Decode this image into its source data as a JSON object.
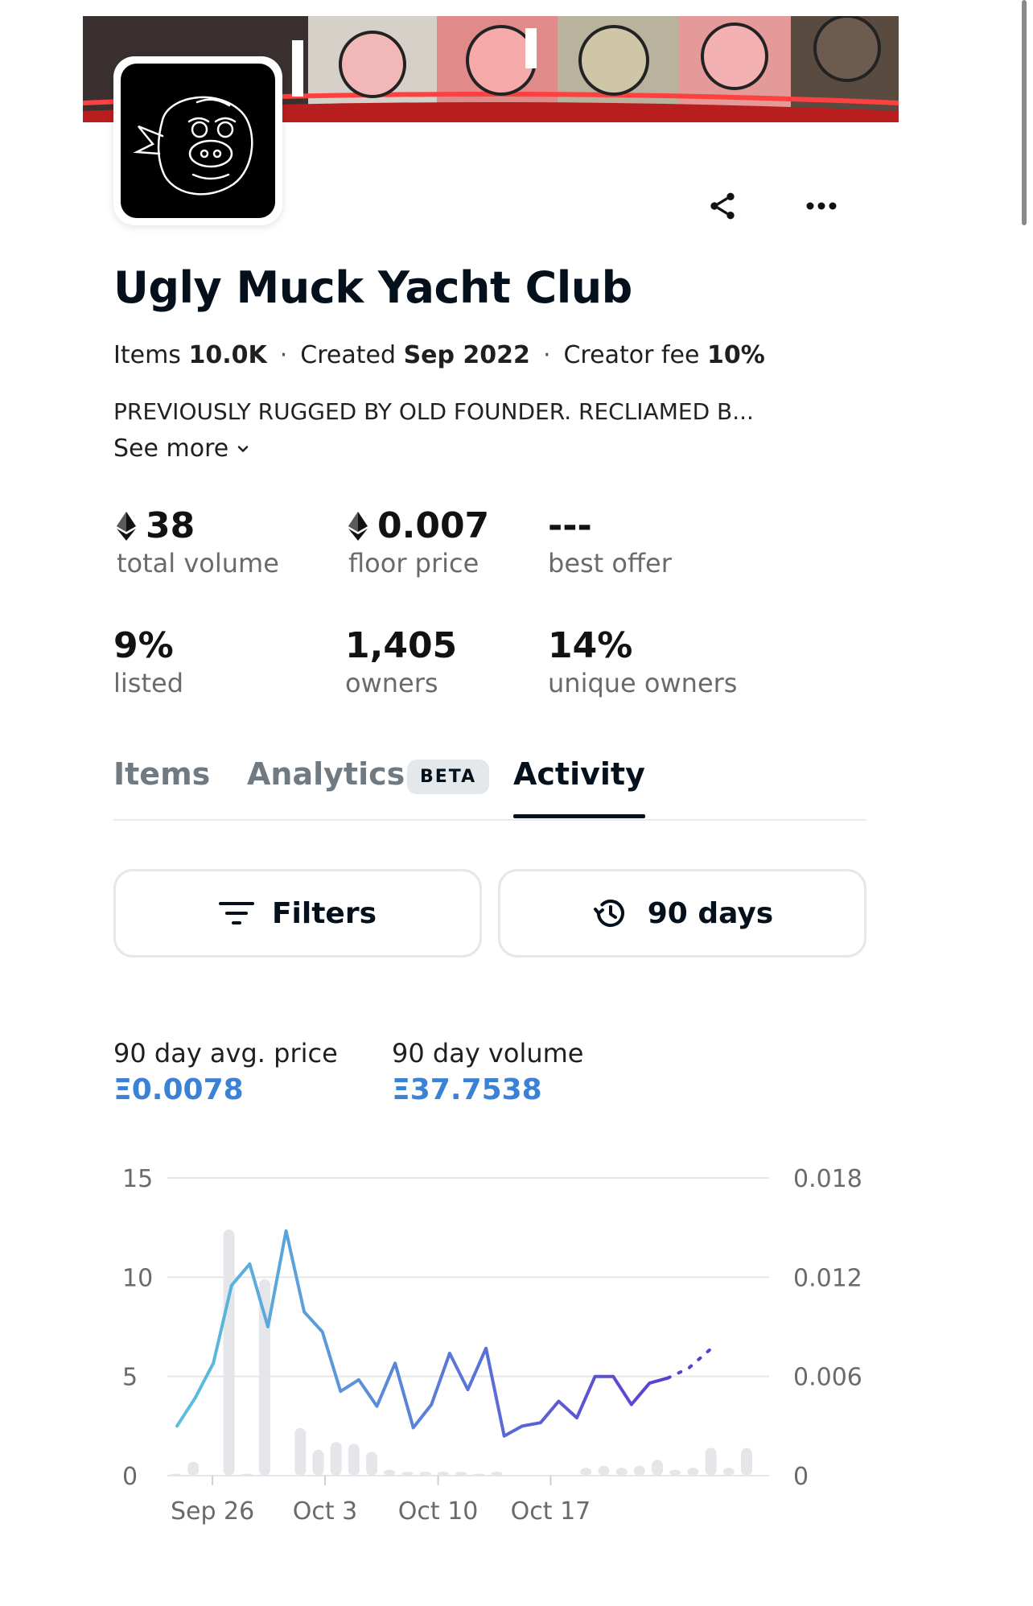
{
  "collection": {
    "name": "Ugly Muck Yacht Club",
    "items_label": "Items",
    "items_value": "10.0K",
    "created_label": "Created",
    "created_value": "Sep 2022",
    "fee_label": "Creator fee",
    "fee_value": "10%",
    "separator": "·",
    "description": "PREVIOUSLY RUGGED BY OLD FOUNDER. RECLIAMED B...",
    "see_more": "See more"
  },
  "stats": [
    {
      "value": "38",
      "label": "total volume",
      "eth": true
    },
    {
      "value": "0.007",
      "label": "floor price",
      "eth": true
    },
    {
      "value": "---",
      "label": "best offer",
      "eth": false
    },
    {
      "value": "9%",
      "label": "listed",
      "eth": false
    },
    {
      "value": "1,405",
      "label": "owners",
      "eth": false
    },
    {
      "value": "14%",
      "label": "unique owners",
      "eth": false
    }
  ],
  "tabs": {
    "items": "Items",
    "analytics": "Analytics",
    "beta": "BETA",
    "activity": "Activity",
    "active": "Activity"
  },
  "controls": {
    "filters": "Filters",
    "range": "90 days"
  },
  "kpis": {
    "avg_price_label": "90 day avg. price",
    "avg_price_value": "Ξ0.0078",
    "volume_label": "90 day volume",
    "volume_value": "Ξ37.7538"
  },
  "icons": {
    "share": "share-icon",
    "more": "more-dots-icon",
    "eth": "ethereum-icon",
    "filter": "filter-lines-icon",
    "history": "history-clock-icon",
    "chevron": "chevron-down-icon"
  },
  "colors": {
    "accent_blue": "#3b82d6",
    "line_start": "#5bc0de",
    "line_end": "#5b3fd1",
    "volume_bar": "#e5e6ea"
  },
  "chart_data": {
    "type": "bar+line",
    "x_ticks": [
      "Sep 26",
      "Oct 3",
      "Oct 10",
      "Oct 17"
    ],
    "y_left_ticks": [
      "0",
      "5",
      "10",
      "15"
    ],
    "y_right_ticks": [
      "0",
      "0.006",
      "0.012",
      "0.018"
    ],
    "ylim_left": [
      0,
      15
    ],
    "ylim_right": [
      0,
      0.018
    ],
    "grid": true,
    "volume_series": {
      "axis": "left",
      "values": [
        0.1,
        0.7,
        0,
        12.4,
        0.1,
        9.9,
        0,
        2.4,
        1.3,
        1.7,
        1.6,
        1.2,
        0.3,
        0.2,
        0.2,
        0.2,
        0.2,
        0.1,
        0.2,
        0,
        0,
        0,
        0,
        0.4,
        0.5,
        0.4,
        0.5,
        0.8,
        0.3,
        0.4,
        1.4,
        0.4,
        1.4
      ]
    },
    "price_series": {
      "axis": "right",
      "values": [
        0.003,
        0.0047,
        0.0068,
        0.0115,
        0.0128,
        0.009,
        0.0148,
        0.0099,
        0.0087,
        0.0051,
        0.0058,
        0.0042,
        0.0068,
        0.0029,
        0.0043,
        0.0074,
        0.0052,
        0.0077,
        0.0024,
        0.003,
        0.0032,
        0.0045,
        0.0035,
        0.006,
        0.006,
        0.0043,
        0.0056,
        0.0059
      ],
      "projected": [
        0.0059,
        0.0065,
        0.0076
      ]
    }
  }
}
